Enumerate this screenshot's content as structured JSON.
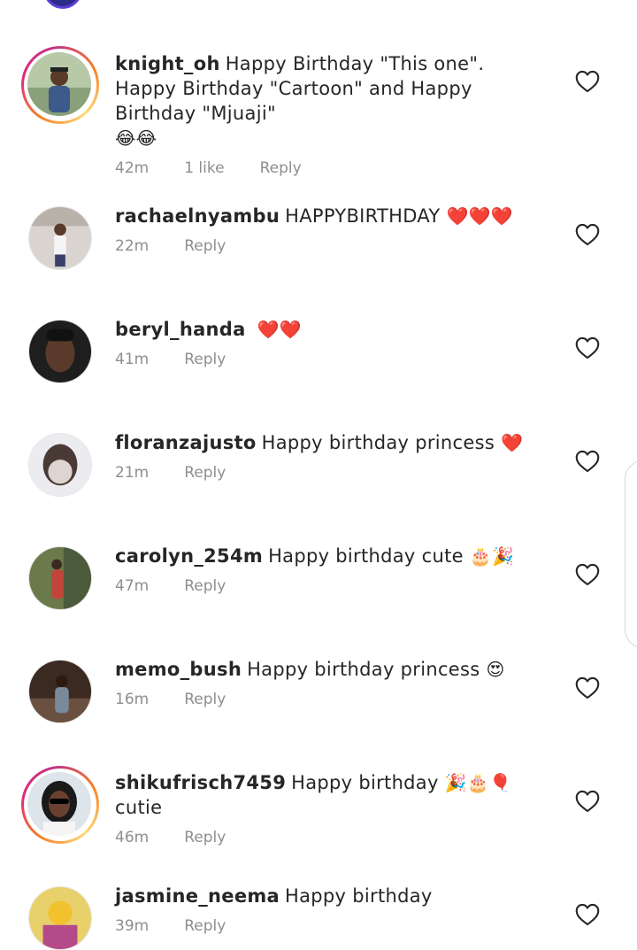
{
  "comments": [
    {
      "username": "knight_oh",
      "text": "Happy Birthday \"This one\". Happy Birthday \"Cartoon\" and Happy Birthday \"Mjuaji\"",
      "emojis": "😂😂",
      "time": "42m",
      "likes": "1 like",
      "reply": "Reply",
      "story_ring": true,
      "avatar_colors": [
        "#9fb8a0",
        "#3c5a8a"
      ]
    },
    {
      "username": "rachaelnyambu",
      "text": "HAPPYBIRTHDAY",
      "emojis": "❤️❤️❤️",
      "time": "22m",
      "reply": "Reply",
      "story_ring": false,
      "avatar_colors": [
        "#d9d4cf",
        "#3a3f6a"
      ]
    },
    {
      "username": "beryl_handa",
      "text": "",
      "emojis": "❤️❤️",
      "time": "41m",
      "reply": "Reply",
      "story_ring": false,
      "avatar_colors": [
        "#2a2a2a",
        "#5a3a2a"
      ]
    },
    {
      "username": "floranzajusto",
      "text": "Happy birthday princess",
      "emojis": "❤️",
      "time": "21m",
      "reply": "Reply",
      "story_ring": false,
      "avatar_colors": [
        "#e9e9ec",
        "#4a3a35"
      ]
    },
    {
      "username": "carolyn_254m",
      "text": "Happy birthday cute",
      "emojis": "🎂🎉",
      "time": "47m",
      "reply": "Reply",
      "story_ring": false,
      "avatar_colors": [
        "#6a7a4a",
        "#c0453a"
      ]
    },
    {
      "username": "memo_bush",
      "text": "Happy birthday princess",
      "emojis": "😍",
      "time": "16m",
      "reply": "Reply",
      "story_ring": false,
      "avatar_colors": [
        "#3a2a22",
        "#7a8a9a"
      ]
    },
    {
      "username": "shikufrisch7459",
      "text": "Happy birthday",
      "emojis": "🎉🎂🎈",
      "text_after": "cutie",
      "time": "46m",
      "reply": "Reply",
      "story_ring": true,
      "avatar_colors": [
        "#dde4ea",
        "#1a1a1a"
      ]
    },
    {
      "username": "jasmine_neema",
      "text": "Happy birthday",
      "emojis": "",
      "time": "39m",
      "reply": "Reply",
      "story_ring": false,
      "avatar_colors": [
        "#f2c12e",
        "#b44a8a"
      ]
    }
  ],
  "icons": {
    "like": "heart-outline-icon"
  }
}
